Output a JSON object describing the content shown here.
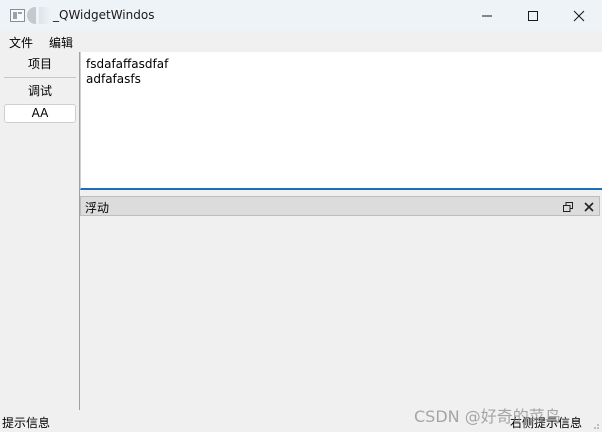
{
  "window": {
    "title": "_QWidgetWindos",
    "icons": [
      "app-icon",
      "app-icon-secondary"
    ],
    "controls": [
      "minimize-icon",
      "maximize-icon",
      "close-icon"
    ]
  },
  "menu": [
    "文件",
    "编辑"
  ],
  "left_panel": {
    "items": [
      "项目",
      "调试",
      "AA"
    ],
    "selected": "AA"
  },
  "editor": {
    "lines": [
      "fsdafaffasdfaf",
      "adfafasfs"
    ],
    "focus_color": "#1f6fb5"
  },
  "dock": {
    "title": "浮动",
    "buttons": [
      "float-icon",
      "close-icon"
    ]
  },
  "status": {
    "left": "提示信息",
    "right": "右侧提示信息"
  },
  "watermark": "CSDN @好奇的菜鸟"
}
